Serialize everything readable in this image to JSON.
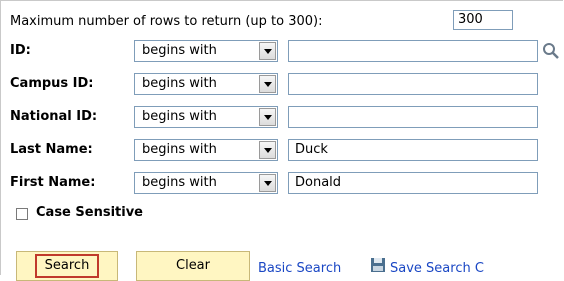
{
  "max_rows": {
    "label": "Maximum number of rows to return (up to 300):",
    "value": "300"
  },
  "fields": [
    {
      "label": "ID:",
      "operator": "begins with",
      "value": ""
    },
    {
      "label": "Campus ID:",
      "operator": "begins with",
      "value": ""
    },
    {
      "label": "National ID:",
      "operator": "begins with",
      "value": ""
    },
    {
      "label": "Last Name:",
      "operator": "begins with",
      "value": "Duck"
    },
    {
      "label": "First Name:",
      "operator": "begins with",
      "value": "Donald"
    }
  ],
  "case_sensitive": {
    "label": "Case Sensitive",
    "checked": false
  },
  "buttons": {
    "search": "Search",
    "clear": "Clear"
  },
  "links": {
    "basic_search": "Basic Search",
    "save_search": "Save Search C"
  },
  "colors": {
    "button_bg": "#fff6c2",
    "link": "#1a47c4",
    "focus_border": "#c0392b"
  }
}
